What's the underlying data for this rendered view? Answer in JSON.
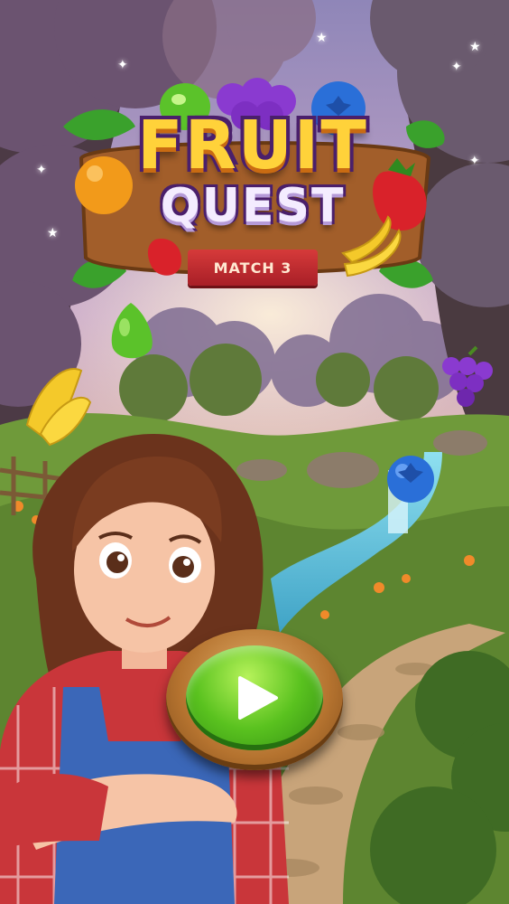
{
  "game": {
    "title_line1": "FRUIT",
    "title_line2": "QUEST",
    "subtitle": "MATCH 3"
  },
  "icons": {
    "play": "play-icon",
    "fruits": [
      "pear-icon",
      "grape-icon",
      "blueberry-icon",
      "orange-icon",
      "strawberry-icon",
      "banana-icon"
    ]
  },
  "colors": {
    "title_yellow": "#ffd23a",
    "title_purple_outline": "#4a1f6b",
    "ribbon_red": "#c62d33",
    "play_green": "#5ac21f",
    "play_frame_wood": "#b5732f"
  }
}
